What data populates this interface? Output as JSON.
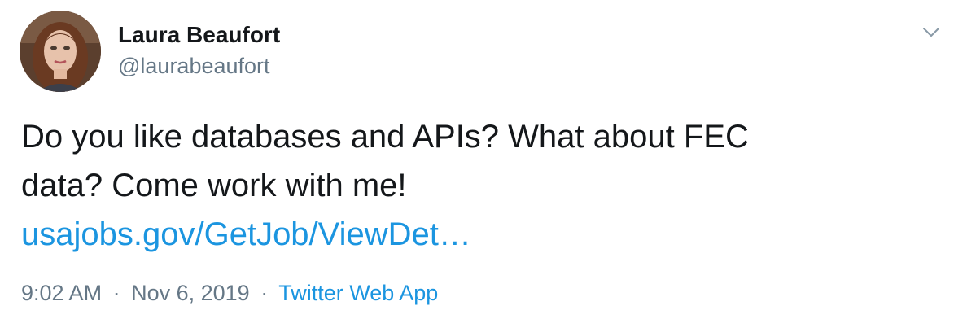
{
  "author": {
    "display_name": "Laura Beaufort",
    "handle": "@laurabeaufort"
  },
  "menu": {
    "icon": "chevron-down-icon"
  },
  "tweet": {
    "line1": "Do you like databases and APIs? What about FEC",
    "line2": "data? Come work with me!",
    "link_text": "usajobs.gov/GetJob/ViewDet…"
  },
  "meta": {
    "time": "9:02 AM",
    "separator": "·",
    "date": "Nov 6, 2019",
    "source": "Twitter Web App"
  },
  "colors": {
    "link": "#1b95e0",
    "secondary_text": "#657786",
    "primary_text": "#14171a"
  }
}
